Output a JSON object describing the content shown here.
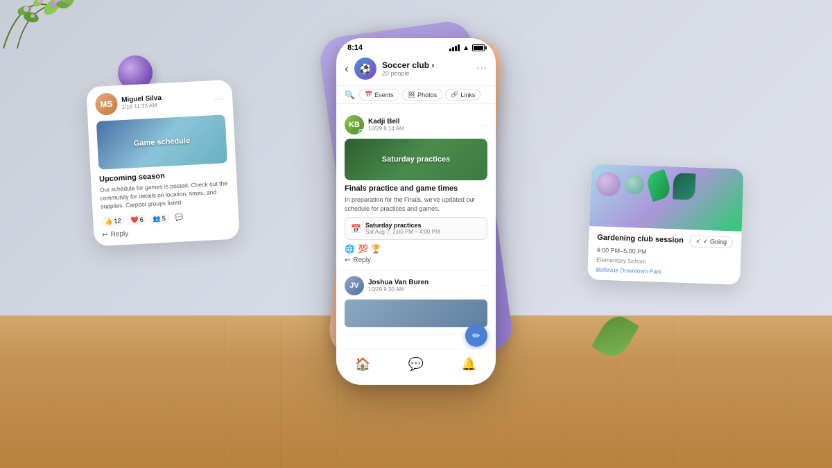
{
  "background": {
    "color": "#d8dce8"
  },
  "phone_main": {
    "status_bar": {
      "time": "8:14",
      "signal": "4 bars",
      "wifi": "wifi",
      "battery": "full"
    },
    "header": {
      "back_label": "‹",
      "group_name": "Soccer club ›",
      "group_count": "20 people",
      "more_options": "···"
    },
    "search": {
      "placeholder": "Search"
    },
    "chips": [
      {
        "label": "Events",
        "icon": "📅"
      },
      {
        "label": "Photos",
        "icon": "🖼"
      },
      {
        "label": "Links",
        "icon": "🔗"
      }
    ],
    "messages": [
      {
        "sender": "Kadji Bell",
        "time": "10/29 8:14 AM",
        "image_label": "Saturday practices",
        "title": "Finals practice and game times",
        "body": "In preparation for the Finals, we've updated our schedule for practices and games.",
        "event_title": "Saturday practices",
        "event_time": "Sat Aug 7, 2:00 PM – 4:00 PM",
        "reactions": [
          "🌐",
          "💯",
          "🏆"
        ],
        "reply_label": "Reply"
      },
      {
        "sender": "Joshua Van Buren",
        "time": "10/29 9:30 AM",
        "image_label": ""
      }
    ],
    "nav": {
      "home": "🏠",
      "chat": "💬",
      "bell": "🔔"
    },
    "fab_label": "✏"
  },
  "card_left": {
    "sender": "Miguel Silva",
    "time": "1/15 11:33 AM",
    "image_label": "Game schedule",
    "title": "Upcoming season",
    "body": "Our schedule for games is posted. Check out the community for details on location, times, and supplies. Carpool groups listed.",
    "reactions": [
      {
        "emoji": "👍",
        "count": "12"
      },
      {
        "emoji": "❤️",
        "count": "6"
      },
      {
        "emoji": "👥",
        "count": "5"
      }
    ],
    "reply_label": "Reply"
  },
  "card_right": {
    "title": "Gardening club session",
    "time": "4:00 PM–5:00 PM",
    "location": "Elementary School",
    "park": "Bellevue Downtown Park",
    "going_label": "✓ Going"
  }
}
